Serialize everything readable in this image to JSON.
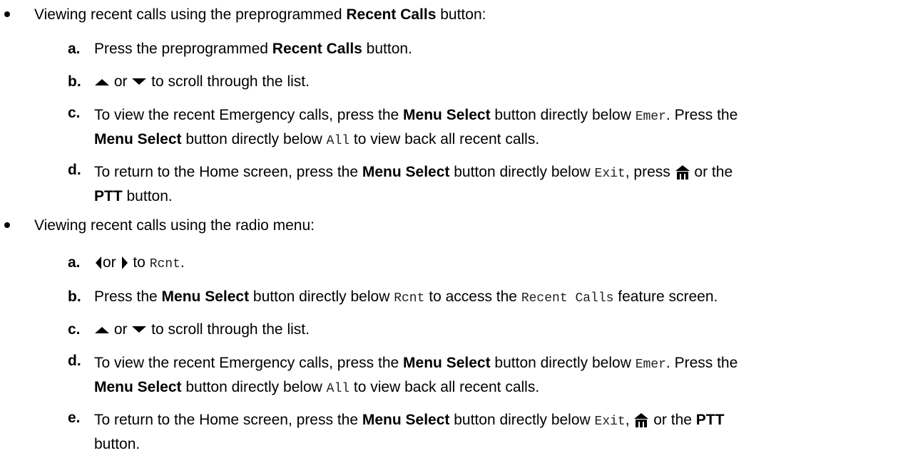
{
  "bullets": [
    {
      "text_1": "Viewing recent calls using the preprogrammed ",
      "bold": "Recent Calls",
      "text_2": " button:"
    },
    {
      "text": "Viewing recent calls using the radio menu:"
    }
  ],
  "section1": {
    "a": {
      "letter": "a.",
      "t1": "Press the preprogrammed ",
      "b1": "Recent Calls",
      "t2": " button."
    },
    "b": {
      "letter": "b.",
      "t1": " or ",
      "t2": " to scroll through the list."
    },
    "c": {
      "letter": "c.",
      "t1": "To view the recent Emergency calls, press the ",
      "b1": "Menu Select",
      "t2": " button directly below ",
      "m1": "Emer",
      "t3": ". Press the",
      "b2": "Menu Select",
      "t4": " button directly below ",
      "m2": "All",
      "t5": " to view back all recent calls."
    },
    "d": {
      "letter": "d.",
      "t1": "To return to the Home screen, press the ",
      "b1": "Menu Select",
      "t2": " button directly below ",
      "m1": "Exit",
      "t3": ", press ",
      "t4": " or the",
      "b2": "PTT",
      "t5": " button."
    }
  },
  "section2": {
    "a": {
      "letter": "a.",
      "t1": "or ",
      "t2": " to ",
      "m1": "Rcnt",
      "t3": "."
    },
    "b": {
      "letter": "b.",
      "t1": "Press the ",
      "b1": "Menu Select",
      "t2": " button directly below ",
      "m1": "Rcnt",
      "t3": " to access the ",
      "m2": "Recent Calls",
      "t4": " feature screen."
    },
    "c": {
      "letter": "c.",
      "t1": " or ",
      "t2": " to scroll through the list."
    },
    "d": {
      "letter": "d.",
      "t1": "To view the recent Emergency calls, press the ",
      "b1": "Menu Select",
      "t2": " button directly below ",
      "m1": "Emer",
      "t3": ". Press the",
      "b2": "Menu Select",
      "t4": " button directly below ",
      "m2": "All",
      "t5": " to view back all recent calls."
    },
    "e": {
      "letter": "e.",
      "t1": "To return to the Home screen, press the ",
      "b1": "Menu Select",
      "t2": " button directly below ",
      "m1": "Exit",
      "t3": ", ",
      "t4": " or the ",
      "b2": "PTT",
      "t5": "button."
    }
  },
  "icons": {
    "up": "up-arrow-icon",
    "down": "down-arrow-icon",
    "left": "left-arrow-icon",
    "right": "right-arrow-icon",
    "home": "home-icon"
  }
}
